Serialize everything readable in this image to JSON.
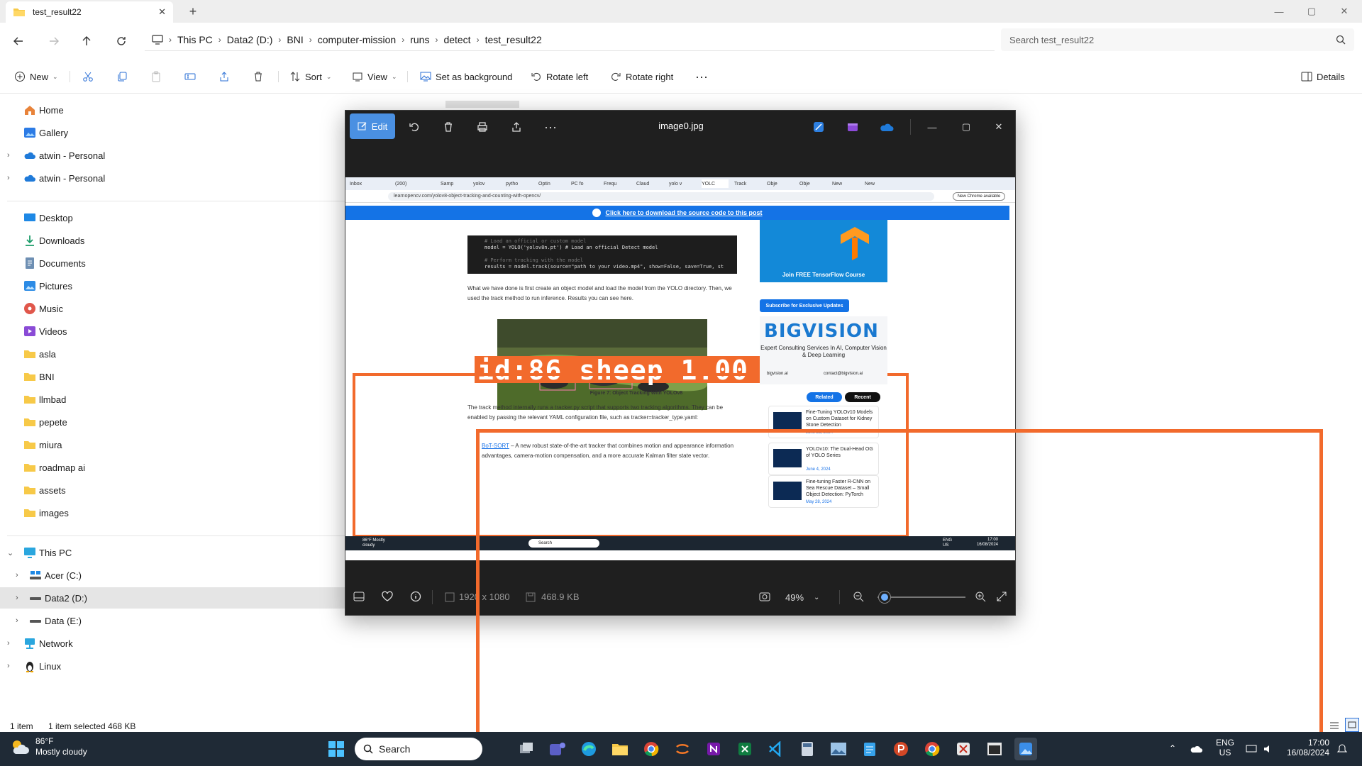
{
  "window": {
    "tab_title": "test_result22",
    "minimize": "—",
    "maximize": "▢",
    "close": "✕"
  },
  "breadcrumb": [
    "This PC",
    "Data2 (D:)",
    "BNI",
    "computer-mission",
    "runs",
    "detect",
    "test_result22"
  ],
  "search": {
    "placeholder": "Search test_result22"
  },
  "toolbar": {
    "new": "New",
    "sort": "Sort",
    "view": "View",
    "set_background": "Set as background",
    "rotate_left": "Rotate left",
    "rotate_right": "Rotate right",
    "more": "···",
    "details": "Details"
  },
  "nav": {
    "quick": [
      {
        "label": "Home",
        "icon": "home-icon"
      },
      {
        "label": "Gallery",
        "icon": "gallery-icon"
      },
      {
        "label": "atwin - Personal",
        "icon": "cloud-icon"
      },
      {
        "label": "atwin - Personal",
        "icon": "cloud-icon"
      }
    ],
    "folders": [
      {
        "label": "Desktop",
        "icon": "desktop-icon"
      },
      {
        "label": "Downloads",
        "icon": "download-icon"
      },
      {
        "label": "Documents",
        "icon": "document-icon"
      },
      {
        "label": "Pictures",
        "icon": "pictures-icon"
      },
      {
        "label": "Music",
        "icon": "music-icon"
      },
      {
        "label": "Videos",
        "icon": "videos-icon"
      },
      {
        "label": "asla",
        "icon": "folder-icon"
      },
      {
        "label": "BNI",
        "icon": "folder-icon"
      },
      {
        "label": "llmbad",
        "icon": "folder-icon"
      },
      {
        "label": "pepete",
        "icon": "folder-icon"
      },
      {
        "label": "miura",
        "icon": "folder-icon"
      },
      {
        "label": "roadmap ai",
        "icon": "folder-icon"
      },
      {
        "label": "assets",
        "icon": "folder-icon"
      },
      {
        "label": "images",
        "icon": "folder-icon"
      }
    ],
    "pc": [
      {
        "label": "This PC",
        "icon": "pc-icon"
      },
      {
        "label": "Acer (C:)",
        "icon": "drive-icon"
      },
      {
        "label": "Data2 (D:)",
        "icon": "drive-icon"
      },
      {
        "label": "Data (E:)",
        "icon": "drive-icon"
      },
      {
        "label": "Network",
        "icon": "network-icon"
      },
      {
        "label": "Linux",
        "icon": "linux-icon"
      }
    ]
  },
  "status": {
    "count": "1 item",
    "selected": "1 item selected  468 KB"
  },
  "viewer": {
    "edit": "Edit",
    "filename": "image0.jpg",
    "dimensions": "1920 x 1080",
    "filesize": "468.9 KB",
    "zoom": "49%",
    "zoom_fraction": 0.08
  },
  "inner": {
    "tabs": [
      "Inbox",
      "(200)",
      "Samp",
      "yolov",
      "pytho",
      "Optin",
      "PC fo",
      "Frequ",
      "Claud",
      "yolo v",
      "YOLC",
      "Track",
      "Obje",
      "Obje",
      "New",
      "New"
    ],
    "url": "learnopencv.com/yolov8-object-tracking-and-counting-with-opencv/",
    "new_chrome": "New Chrome available",
    "banner": "Click here to download the source code to this post",
    "code_lines": [
      {
        "n": "1",
        "t": "# Load an official or custom model"
      },
      {
        "n": "2",
        "t": "model = YOLO('yolov8n.pt')  # Load an official Detect model"
      },
      {
        "n": "3",
        "t": ""
      },
      {
        "n": "4",
        "t": "# Perform tracking with the model"
      },
      {
        "n": "5",
        "t": "results = model.track(source=\"path to your video.mp4\", show=False, save=True, st"
      }
    ],
    "para1": "What we have done is first create an object model and load the model from the YOLO directory. Then, we used the track method to run inference. Results you can see here.",
    "figure_caption": "Figure 7: Object Tracking With YOLOv8",
    "para2a": "The track method internally runs a tracker.py script that supports two tracking algorithms.",
    "para2b": "They can be enabled by passing the relevant YAML configuration file, such as",
    "para2c": "tracker=tracker_type.yaml:",
    "botsort": "BoT-SORT",
    "botsort_desc": "– A new robust state-of-the-art tracker that combines motion and appearance information advantages, camera-motion compensation, and a more accurate Kalman filter state vector.",
    "tf_course": "Join FREE TensorFlow Course",
    "subscribe": "Subscribe for Exclusive Updates",
    "bigvision": "BIGVISION",
    "bigvision_sub": "Expert Consulting Services In AI, Computer Vision & Deep Learning",
    "bv_contact1": "bigvision.ai",
    "bv_contact2": "contact@bigvision.ai",
    "related": "Related",
    "recent": "Recent",
    "posts": [
      {
        "title": "Fine-Tuning YOLOv10 Models on Custom Dataset for Kidney Stone Detection",
        "date": "June 25, 2024"
      },
      {
        "title": "YOLOv10: The Dual-Head OG of YOLO Series",
        "date": "June 4, 2024"
      },
      {
        "title": "Fine-tuning Faster R-CNN on Sea Rescue Dataset – Small Object Detection: PyTorch",
        "date": "May 28, 2024"
      }
    ],
    "weather": "86°F Mostly cloudy",
    "task_search": "Search",
    "tray_lang": "ENG US",
    "tray_time": "17:00",
    "tray_date": "16/08/2024",
    "det_small": "id:86 sheep (",
    "det_big": "id:86 sheep 1.00"
  },
  "taskbar": {
    "temp": "86°F",
    "condition": "Mostly cloudy",
    "search": "Search",
    "lang1": "ENG",
    "lang2": "US",
    "time": "17:00",
    "date": "16/08/2024"
  },
  "colors": {
    "accent": "#4a90e2",
    "detect_box": "#f26a2c",
    "banner": "#1473e6"
  }
}
